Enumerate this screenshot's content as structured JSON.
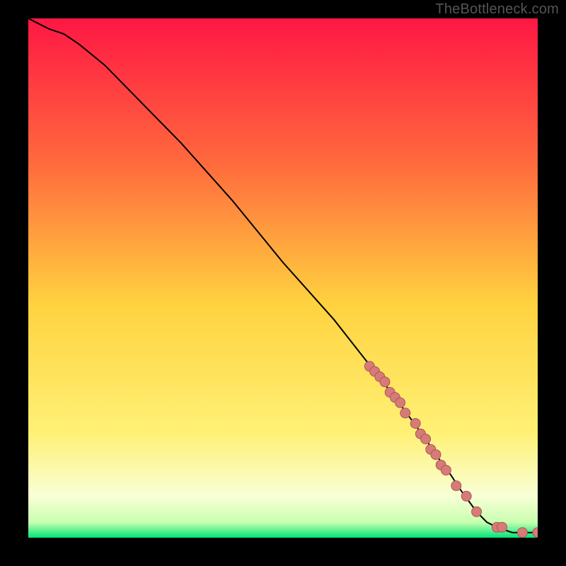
{
  "attribution": {
    "watermark": "TheBottleneck.com"
  },
  "colors": {
    "frame_bg": "#000000",
    "gradient_top": "#ff1744",
    "gradient_mid_upper": "#ff8a3d",
    "gradient_mid": "#ffd23f",
    "gradient_mid_lower": "#fff59d",
    "gradient_band": "#f6ffcc",
    "gradient_base": "#00e676",
    "curve_stroke": "#000000",
    "marker_fill": "#d87a78",
    "marker_stroke": "#a55a58"
  },
  "chart_data": {
    "type": "line",
    "title": "",
    "xlabel": "",
    "ylabel": "",
    "xlim": [
      0,
      100
    ],
    "ylim": [
      0,
      100
    ],
    "grid": false,
    "legend": false,
    "series": [
      {
        "name": "bottleneck-curve",
        "x": [
          0,
          2,
          4,
          7,
          10,
          15,
          20,
          30,
          40,
          50,
          60,
          68,
          72,
          75,
          78,
          80,
          83,
          85,
          88,
          90,
          92,
          95,
          98,
          100
        ],
        "y": [
          100,
          99,
          98,
          97,
          95,
          91,
          86,
          76,
          65,
          53,
          42,
          32,
          27,
          23,
          19,
          16,
          12,
          9,
          5,
          3,
          2,
          1,
          1,
          1
        ]
      }
    ],
    "markers": {
      "name": "observed-points",
      "x": [
        67,
        68,
        69,
        70,
        71,
        72,
        73,
        74,
        76,
        77,
        78,
        79,
        80,
        81,
        82,
        84,
        86,
        88,
        92,
        93,
        97,
        100
      ],
      "y": [
        33,
        32,
        31,
        30,
        28,
        27,
        26,
        24,
        22,
        20,
        19,
        17,
        16,
        14,
        13,
        10,
        8,
        5,
        2,
        2,
        1,
        1
      ]
    }
  }
}
